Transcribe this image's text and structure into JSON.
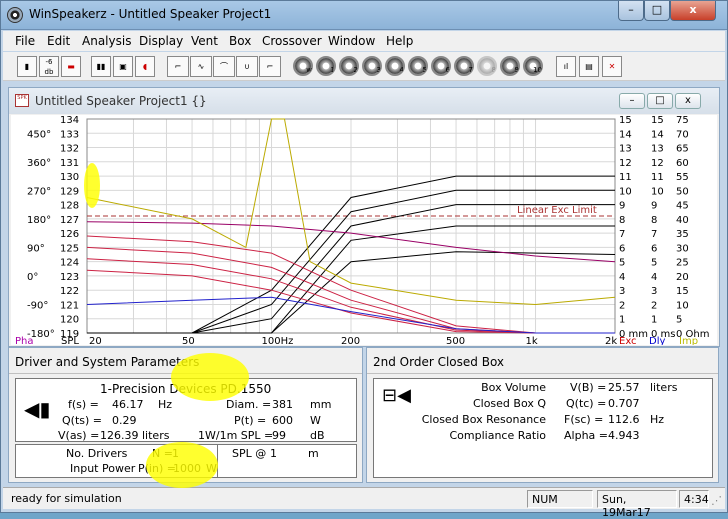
{
  "window": {
    "title": "WinSpeakerz - Untitled Speaker Project1",
    "min": "–",
    "max": "□",
    "close": "x"
  },
  "menu": [
    "File",
    "Edit",
    "Analysis",
    "Display",
    "Vent",
    "Box",
    "Crossover",
    "Window",
    "Help"
  ],
  "toolbar": {
    "db_label": "-6 db",
    "round_numbers": [
      "w",
      "1",
      "2",
      "3",
      "4",
      "5",
      "6",
      "7",
      "8",
      "9",
      "10"
    ]
  },
  "doc": {
    "title": "Untitled Speaker Project1 {}",
    "icon_text": "SPK"
  },
  "chart_data": {
    "type": "line",
    "xscale": "log",
    "xlim": [
      20,
      2000
    ],
    "x_ticks": [
      "20",
      "50",
      "100Hz",
      "200",
      "500",
      "1k",
      "2k"
    ],
    "left_phase": [
      "450°",
      "360°",
      "270°",
      "180°",
      "90°",
      "0°",
      "-90°",
      "-180°"
    ],
    "left_spl": [
      "134",
      "133",
      "132",
      "131",
      "130",
      "129",
      "128",
      "127",
      "126",
      "125",
      "124",
      "123",
      "122",
      "121",
      "120",
      "119"
    ],
    "right1": [
      "15",
      "14",
      "13",
      "12",
      "11",
      "10",
      "9",
      "8",
      "7",
      "6",
      "5",
      "4",
      "3",
      "2",
      "1",
      "0 mm"
    ],
    "right2": [
      "15",
      "14",
      "13",
      "12",
      "11",
      "10",
      "9",
      "8",
      "7",
      "6",
      "5",
      "4",
      "3",
      "2",
      "1",
      "0 ms"
    ],
    "right3": [
      "75",
      "70",
      "65",
      "60",
      "55",
      "50",
      "45",
      "40",
      "35",
      "30",
      "25",
      "20",
      "15",
      "10",
      "5",
      "0 Ohm"
    ],
    "ylabel_left": "Pha",
    "xlabel_left": "SPL",
    "bottom_right_labels": [
      "Exc",
      "Dly",
      "Imp"
    ],
    "annotation": "Linear Exc Limit",
    "series": [
      {
        "color": "#000000",
        "values": [
          [
            20,
            101
          ],
          [
            50,
            110
          ],
          [
            100,
            122
          ],
          [
            200,
            128.5
          ],
          [
            500,
            130
          ],
          [
            2000,
            130
          ]
        ]
      },
      {
        "color": "#000000",
        "values": [
          [
            20,
            100
          ],
          [
            50,
            109
          ],
          [
            100,
            121
          ],
          [
            200,
            127.5
          ],
          [
            500,
            129
          ],
          [
            2000,
            129
          ]
        ]
      },
      {
        "color": "#000000",
        "values": [
          [
            20,
            99
          ],
          [
            50,
            108
          ],
          [
            100,
            120
          ],
          [
            200,
            126.5
          ],
          [
            500,
            128
          ],
          [
            2000,
            128
          ]
        ]
      },
      {
        "color": "#000000",
        "values": [
          [
            20,
            98
          ],
          [
            50,
            107
          ],
          [
            100,
            119
          ],
          [
            200,
            125.5
          ],
          [
            500,
            126.5
          ],
          [
            2000,
            126.5
          ]
        ]
      },
      {
        "color": "#000000",
        "values": [
          [
            20,
            97
          ],
          [
            50,
            106
          ],
          [
            100,
            118
          ],
          [
            200,
            124
          ],
          [
            500,
            124.7
          ],
          [
            2000,
            124.5
          ]
        ]
      },
      {
        "color": "#990066",
        "values": [
          [
            20,
            126.8
          ],
          [
            50,
            126.7
          ],
          [
            100,
            126.5
          ],
          [
            200,
            126
          ],
          [
            500,
            125
          ],
          [
            1000,
            124.4
          ],
          [
            2000,
            124
          ]
        ]
      },
      {
        "color": "#cc2244",
        "values": [
          [
            20,
            125.8
          ],
          [
            50,
            125.4
          ],
          [
            100,
            124.6
          ],
          [
            200,
            122
          ],
          [
            500,
            119.5
          ],
          [
            1000,
            119
          ],
          [
            2000,
            119
          ]
        ]
      },
      {
        "color": "#cc2244",
        "values": [
          [
            20,
            125
          ],
          [
            50,
            124.6
          ],
          [
            100,
            123.6
          ],
          [
            200,
            121.3
          ],
          [
            500,
            119.3
          ],
          [
            1000,
            119
          ],
          [
            2000,
            119
          ]
        ]
      },
      {
        "color": "#cc2244",
        "values": [
          [
            20,
            124.2
          ],
          [
            50,
            123.8
          ],
          [
            100,
            122.8
          ],
          [
            200,
            120.8
          ],
          [
            500,
            119.2
          ],
          [
            1000,
            119
          ],
          [
            2000,
            119
          ]
        ]
      },
      {
        "color": "#cc2244",
        "values": [
          [
            20,
            123.4
          ],
          [
            50,
            123
          ],
          [
            100,
            122
          ],
          [
            200,
            120.4
          ],
          [
            500,
            119.1
          ],
          [
            1000,
            119
          ],
          [
            2000,
            119
          ]
        ]
      },
      {
        "color": "#2222cc",
        "values": [
          [
            20,
            121
          ],
          [
            50,
            121.3
          ],
          [
            100,
            121.5
          ],
          [
            200,
            120.5
          ],
          [
            500,
            119.3
          ],
          [
            1000,
            119
          ],
          [
            2000,
            119
          ]
        ]
      },
      {
        "color": "#bbaa00",
        "values": [
          [
            20,
            128.5
          ],
          [
            50,
            127
          ],
          [
            80,
            125
          ],
          [
            100,
            134
          ],
          [
            112,
            134
          ],
          [
            140,
            124
          ],
          [
            200,
            122.5
          ],
          [
            500,
            121.3
          ],
          [
            1000,
            121
          ],
          [
            2000,
            121.5
          ]
        ]
      }
    ],
    "exc_limit_level": 127.2
  },
  "params": {
    "title": "Driver and System Parameters",
    "driver": "1-Precision Devices PD.1550",
    "fs_label": "f(s) =",
    "fs": "46.17",
    "fs_unit": "Hz",
    "diam_label": "Diam. =",
    "diam": "381",
    "diam_unit": "mm",
    "qts_label": "Q(ts) =",
    "qts": "0.29",
    "pt_label": "P(t) =",
    "pt": "600",
    "pt_unit": "W",
    "vas_label": "V(as) =",
    "vas": "126.39",
    "vas_unit": "liters",
    "spl_label": "1W/1m  SPL =",
    "spl": "99",
    "spl_unit": "dB",
    "nd_label": "No. Drivers",
    "nd_eq": "N =",
    "nd": "1",
    "splat_label": "SPL @",
    "splat": "1",
    "splat_unit": "m",
    "ip_label": "Input Power",
    "ip_eq": "P(in) =",
    "ip": "1000",
    "ip_unit": "W"
  },
  "box": {
    "title": "2nd Order Closed Box",
    "rows": [
      {
        "label": "Box Volume",
        "var": "V(B) =",
        "val": "25.57",
        "unit": "liters"
      },
      {
        "label": "Closed Box Q",
        "var": "Q(tc) =",
        "val": "0.707",
        "unit": ""
      },
      {
        "label": "Closed Box Resonance",
        "var": "F(sc) =",
        "val": "112.6",
        "unit": "Hz"
      },
      {
        "label": "Compliance Ratio",
        "var": "Alpha =",
        "val": "4.943",
        "unit": ""
      }
    ]
  },
  "status": {
    "text": "ready for simulation",
    "num": "NUM",
    "date": "Sun, 19Mar17",
    "time": "4:34"
  }
}
